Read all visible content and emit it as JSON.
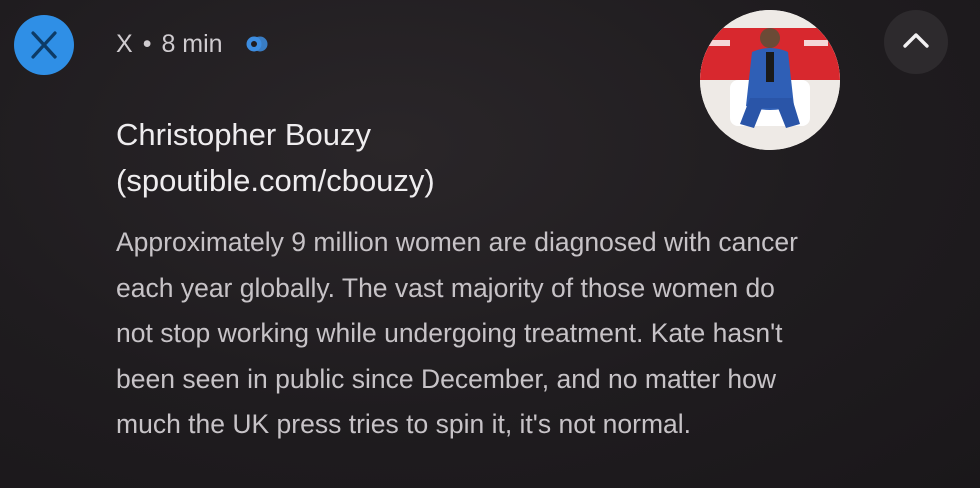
{
  "notification": {
    "app_name": "X",
    "separator": "•",
    "time_ago": "8 min",
    "title_line1": "Christopher Bouzy",
    "title_line2": "(spoutible.com/cbouzy)",
    "body_lines": [
      "Approximately 9 million women are diagnosed with cancer",
      "each year globally. The vast majority of those women do",
      "not stop working while undergoing treatment. Kate hasn't",
      "been seen in public since December, and no matter how",
      "much the UK press tries to spin it, it's not normal."
    ]
  },
  "icons": {
    "app": "x-logo-icon",
    "status": "sync-icon",
    "collapse": "chevron-up-icon"
  },
  "colors": {
    "background": "#201d20",
    "app_icon_bg": "#2f8fe6",
    "accent": "#3d8de0",
    "text_primary": "#efedef",
    "text_secondary": "#c7c3c7"
  }
}
